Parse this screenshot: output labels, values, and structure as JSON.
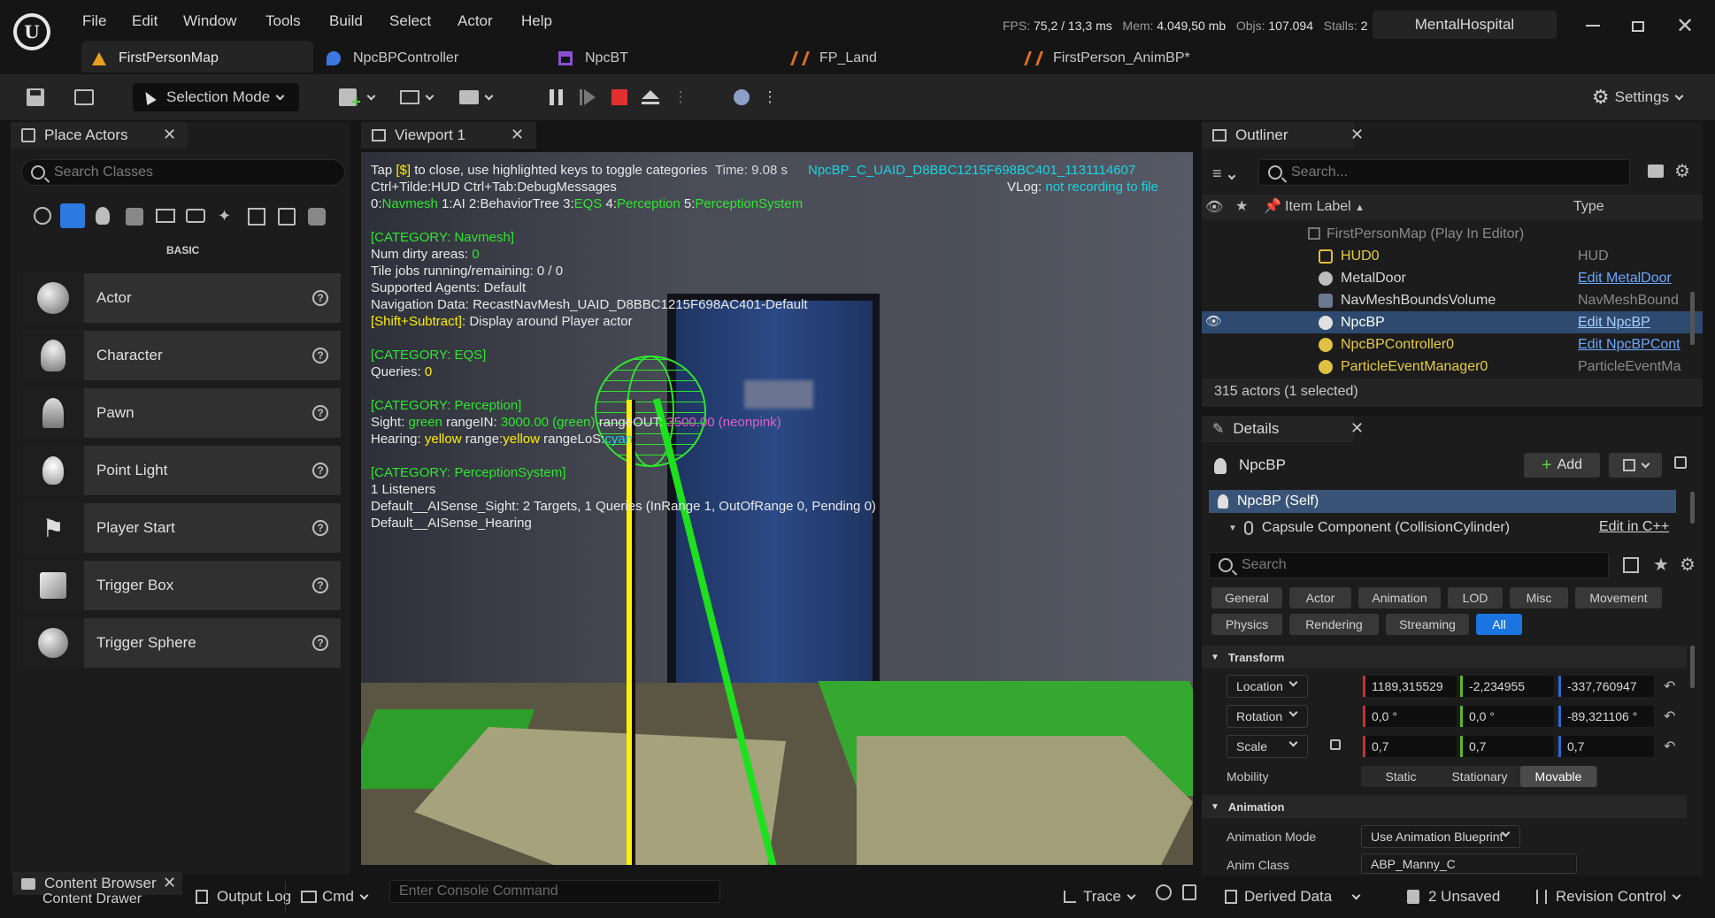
{
  "menu": [
    "File",
    "Edit",
    "Window",
    "Tools",
    "Build",
    "Select",
    "Actor",
    "Help"
  ],
  "tabs": [
    {
      "label": "FirstPersonMap",
      "color": "#e8a020"
    },
    {
      "label": "NpcBPController",
      "color": "#3a7ae0"
    },
    {
      "label": "NpcBT",
      "color": "#8a50d0"
    },
    {
      "label": "FP_Land",
      "color": "#e07020"
    },
    {
      "label": "FirstPerson_AnimBP*",
      "color": "#e07020"
    }
  ],
  "stats": {
    "fps_label": "FPS:",
    "fps": "75,2 / 13,3 ms",
    "mem_label": "Mem:",
    "mem": "4.049,50 mb",
    "objs_label": "Objs:",
    "objs": "107.094",
    "stalls_label": "Stalls:",
    "stalls": "2"
  },
  "project": "MentalHospital",
  "toolbar": {
    "selection_mode": "Selection Mode",
    "settings": "Settings"
  },
  "place_actors": {
    "tab": "Place Actors",
    "search_placeholder": "Search Classes",
    "category": "BASIC",
    "items": [
      "Actor",
      "Character",
      "Pawn",
      "Point Light",
      "Player Start",
      "Trigger Box",
      "Trigger Sphere"
    ]
  },
  "viewport": {
    "tab": "Viewport 1",
    "lines": {
      "tap_pre": "Tap ",
      "tap_key": "[$]",
      "tap_post": " to close, use highlighted keys to toggle categories",
      "overlap_a": "Time: 9.08 s",
      "actor": "NpcBP_C_UAID_D8BBC1215F698BC401_1131114607",
      "ctrl": "Ctrl+Tilde:HUD  Ctrl+Tab:DebugMessages",
      "vlog_label": "VLog: ",
      "vlog": "not recording to file",
      "cats": [
        "0:",
        "Navmesh",
        "  1:",
        "AI",
        "  2:",
        "BehaviorTree",
        "  3:",
        "EQS",
        "  4:",
        "Perception",
        "  5:",
        "PerceptionSystem"
      ],
      "cat_navmesh": "[CATEGORY: Navmesh]",
      "dirty_label": "Num dirty areas: ",
      "dirty": "0",
      "tile": "Tile jobs running/remaining: 0 / 0",
      "agents": "Supported Agents: Default",
      "navdata": "Navigation Data: RecastNavMesh_UAID_D8BBC1215F698AC401-Default",
      "shift_key": "[Shift+Subtract]",
      "shift_post": ": Display around Player actor",
      "cat_eqs": "[CATEGORY: EQS]",
      "queries_label": "Queries: ",
      "queries": "0",
      "cat_perception": "[CATEGORY: Perception]",
      "sight_label": "Sight: ",
      "sight_green": "green",
      "sight_rin": " rangeIN: ",
      "sight_rin_v": "3000.00 (green)",
      "sight_rout": "  rangeOUT: ",
      "sight_rout_v": "3500.00 (neonpink)",
      "hearing_label": "Hearing: ",
      "hearing_y": "yellow",
      "hearing_range": " range:",
      "hearing_range_v": "yellow",
      "hearing_los": "  rangeLoS:",
      "hearing_los_v": "cyan",
      "cat_ps": "[CATEGORY: PerceptionSystem]",
      "listeners": "1 Listeners",
      "aisight": "Default__AISense_Sight: 2 Targets, 1 Queries (InRange 1, OutOfRange 0, Pending 0)",
      "aihearing": "Default__AISense_Hearing"
    }
  },
  "outliner": {
    "tab": "Outliner",
    "search_placeholder": "Search...",
    "col_label": "Item Label",
    "col_type": "Type",
    "rows": [
      {
        "name": "FirstPersonMap (Play In Editor)",
        "type": "",
        "style": "dim"
      },
      {
        "name": "HUD0",
        "type": "HUD",
        "style": "yellow"
      },
      {
        "name": "MetalDoor",
        "type": "Edit MetalDoor",
        "style": "link"
      },
      {
        "name": "NavMeshBoundsVolume",
        "type": "NavMeshBound",
        "style": "plain"
      },
      {
        "name": "NpcBP",
        "type": "Edit NpcBP",
        "style": "selected"
      },
      {
        "name": "NpcBPController0",
        "type": "Edit NpcBPCont",
        "style": "yellowlink"
      },
      {
        "name": "ParticleEventManager0",
        "type": "ParticleEventMa",
        "style": "yellow"
      }
    ],
    "count": "315 actors (1 selected)"
  },
  "details": {
    "tab": "Details",
    "object": "NpcBP",
    "add": "Add",
    "self": "NpcBP (Self)",
    "component": "Capsule Component (CollisionCylinder)",
    "edit_cpp": "Edit in C++",
    "search_placeholder": "Search",
    "filters_row1": [
      "General",
      "Actor",
      "Animation",
      "LOD",
      "Misc",
      "Movement"
    ],
    "filters_row2": [
      "Physics",
      "Rendering",
      "Streaming",
      "All"
    ],
    "transform": "Transform",
    "location": "Location",
    "loc": [
      "1189,315529",
      "-2,234955",
      "-337,760947"
    ],
    "rotation": "Rotation",
    "rot": [
      "0,0 °",
      "0,0 °",
      "-89,321106 °"
    ],
    "scale": "Scale",
    "scl": [
      "0,7",
      "0,7",
      "0,7"
    ],
    "mobility": "Mobility",
    "mob_opts": [
      "Static",
      "Stationary",
      "Movable"
    ],
    "animation": "Animation",
    "anim_mode_label": "Animation Mode",
    "anim_mode": "Use Animation Blueprint",
    "anim_class_label": "Anim Class",
    "anim_class": "ABP_Manny_C"
  },
  "bottom": {
    "content_browser": "Content Browser",
    "content_drawer": "Content Drawer",
    "output_log": "Output Log",
    "cmd": "Cmd",
    "console_placeholder": "Enter Console Command",
    "trace": "Trace",
    "derived": "Derived Data",
    "unsaved": "2 Unsaved",
    "revision": "Revision Control"
  }
}
